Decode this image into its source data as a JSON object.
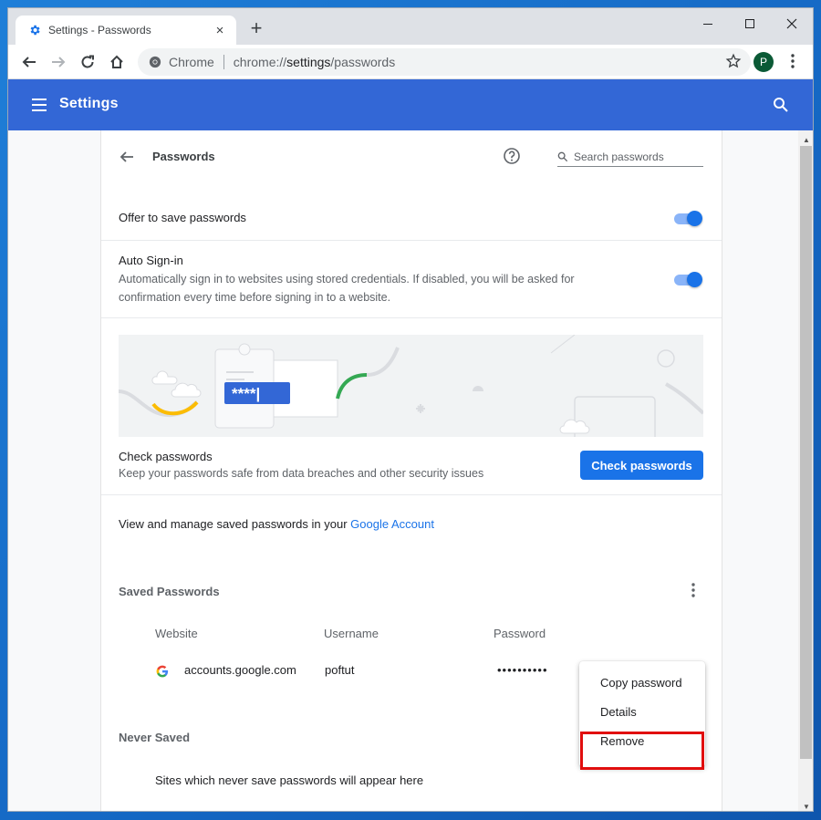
{
  "window": {
    "tab_title": "Settings - Passwords",
    "tab_close": "×",
    "new_tab": "+"
  },
  "toolbar": {
    "omnibox_chrome_label": "Chrome",
    "url_prefix": "chrome://",
    "url_host": "settings",
    "url_path": "/passwords",
    "avatar_initial": "P"
  },
  "header": {
    "title": "Settings"
  },
  "page": {
    "title": "Passwords",
    "search_placeholder": "Search passwords",
    "offer_to_save": {
      "label": "Offer to save passwords",
      "enabled": true
    },
    "auto_signin": {
      "label": "Auto Sign-in",
      "description": "Automatically sign in to websites using stored credentials. If disabled, you will be asked for confirmation every time before signing in to a website.",
      "enabled": true
    },
    "illustration_stars": "****|",
    "check": {
      "title": "Check passwords",
      "description": "Keep your passwords safe from data breaches and other security issues",
      "button": "Check passwords"
    },
    "google_account": {
      "text": "View and manage saved passwords in your ",
      "link": "Google Account"
    },
    "saved": {
      "title": "Saved Passwords",
      "columns": [
        "Website",
        "Username",
        "Password"
      ],
      "rows": [
        {
          "website": "accounts.google.com",
          "username": "poftut",
          "password": "••••••••••"
        }
      ]
    },
    "never_saved": {
      "title": "Never Saved",
      "empty_text": "Sites which never save passwords will appear here"
    }
  },
  "context_menu": {
    "items": [
      "Copy password",
      "Details",
      "Remove"
    ],
    "highlighted": "Remove",
    "highlight_color": "#e10e0e"
  },
  "colors": {
    "header_bg": "#3367d6",
    "accent": "#1a73e8",
    "avatar_bg": "#0b5a36"
  }
}
